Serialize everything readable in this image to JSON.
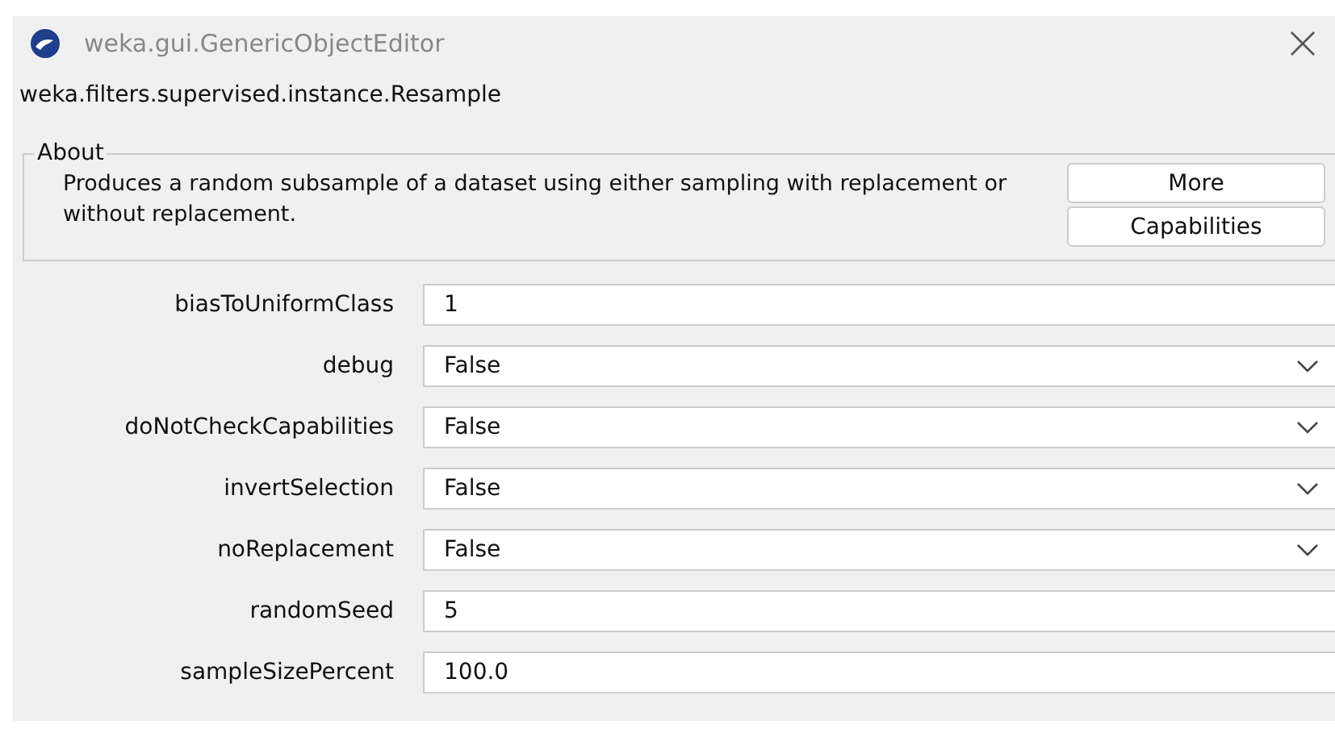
{
  "window": {
    "title": "weka.gui.GenericObjectEditor"
  },
  "class_name": "weka.filters.supervised.instance.Resample",
  "about": {
    "legend": "About",
    "description": "Produces a random subsample of a dataset using either sampling with replacement or without replacement.",
    "buttons": [
      "More",
      "Capabilities"
    ]
  },
  "properties": [
    {
      "label": "biasToUniformClass",
      "kind": "text",
      "value": "1"
    },
    {
      "label": "debug",
      "kind": "dropdown",
      "value": "False"
    },
    {
      "label": "doNotCheckCapabilities",
      "kind": "dropdown",
      "value": "False"
    },
    {
      "label": "invertSelection",
      "kind": "dropdown",
      "value": "False"
    },
    {
      "label": "noReplacement",
      "kind": "dropdown",
      "value": "False"
    },
    {
      "label": "randomSeed",
      "kind": "text",
      "value": "5"
    },
    {
      "label": "sampleSizePercent",
      "kind": "text",
      "value": "100.0"
    }
  ]
}
